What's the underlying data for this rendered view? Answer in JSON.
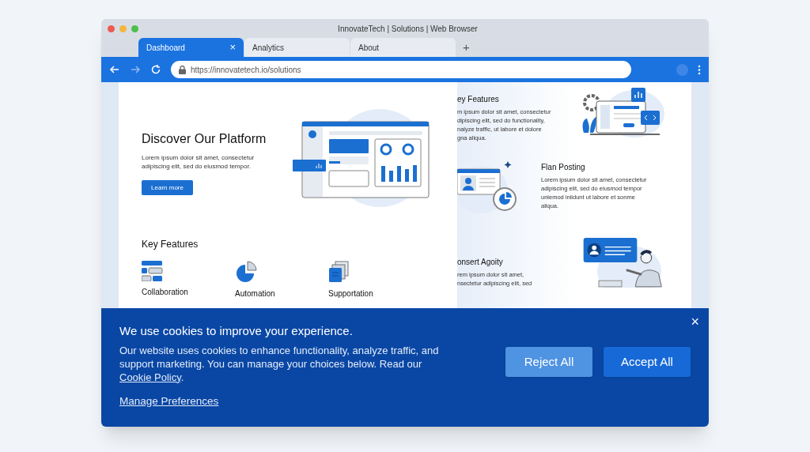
{
  "window": {
    "title": "InnovateTech | Solutions | Web Browser"
  },
  "tabs": [
    {
      "label": "Dashboard",
      "selected": true,
      "close": "×"
    },
    {
      "label": "Analytics",
      "selected": false
    },
    {
      "label": "About",
      "selected": false
    }
  ],
  "new_tab": "+",
  "address_bar": {
    "url": "https://innovatetech.io/solutions"
  },
  "hero": {
    "title": "Discover Our Platform",
    "text": "Lorem ipsum dolor sit amet, consectetur adipiscing elit, sed do eiusmod tempor.",
    "button": "Learn more"
  },
  "key_features": {
    "title": "Key Features",
    "items": [
      {
        "kind": "collaboration",
        "label": "Collaboration"
      },
      {
        "kind": "automation",
        "label": "Automation"
      },
      {
        "kind": "support",
        "label": "Supportation"
      }
    ]
  },
  "side_sections": [
    {
      "kind": "laptop",
      "title": "ey Features",
      "lines": [
        "m ipsum dolor sit amet, consectetur",
        "dipiscing elit, sed do functionality,",
        "nalyze traffic, ut labore et dolore",
        "gna aliqua."
      ]
    },
    {
      "kind": "profile",
      "title": "Flan Posting",
      "lines": [
        "Lorem ipsum dolor sit amet, consectetur",
        "adipiscing elit, sed do eiusmod tempor",
        "uniemod iniidunt ut labore et sonme",
        "aliqua."
      ]
    },
    {
      "kind": "person",
      "title": "onsert Agoity",
      "lines": [
        "rem ipsum dolor sit amet,",
        "nsectetur adipiscing elit, sed"
      ]
    }
  ],
  "cookie_banner": {
    "title": "We use cookies to improve your experience.",
    "text": "Our website uses cookies to enhance functionality, analyze traffic, and support marketing. You can manage your choices below. Read our",
    "link": "Cookie Policy",
    "after_link": ".",
    "manage": "Manage Preferences",
    "close": "×",
    "buttons": [
      {
        "kind": "secondary",
        "label": "Reject All"
      },
      {
        "kind": "primary",
        "label": "Accept All"
      }
    ]
  }
}
